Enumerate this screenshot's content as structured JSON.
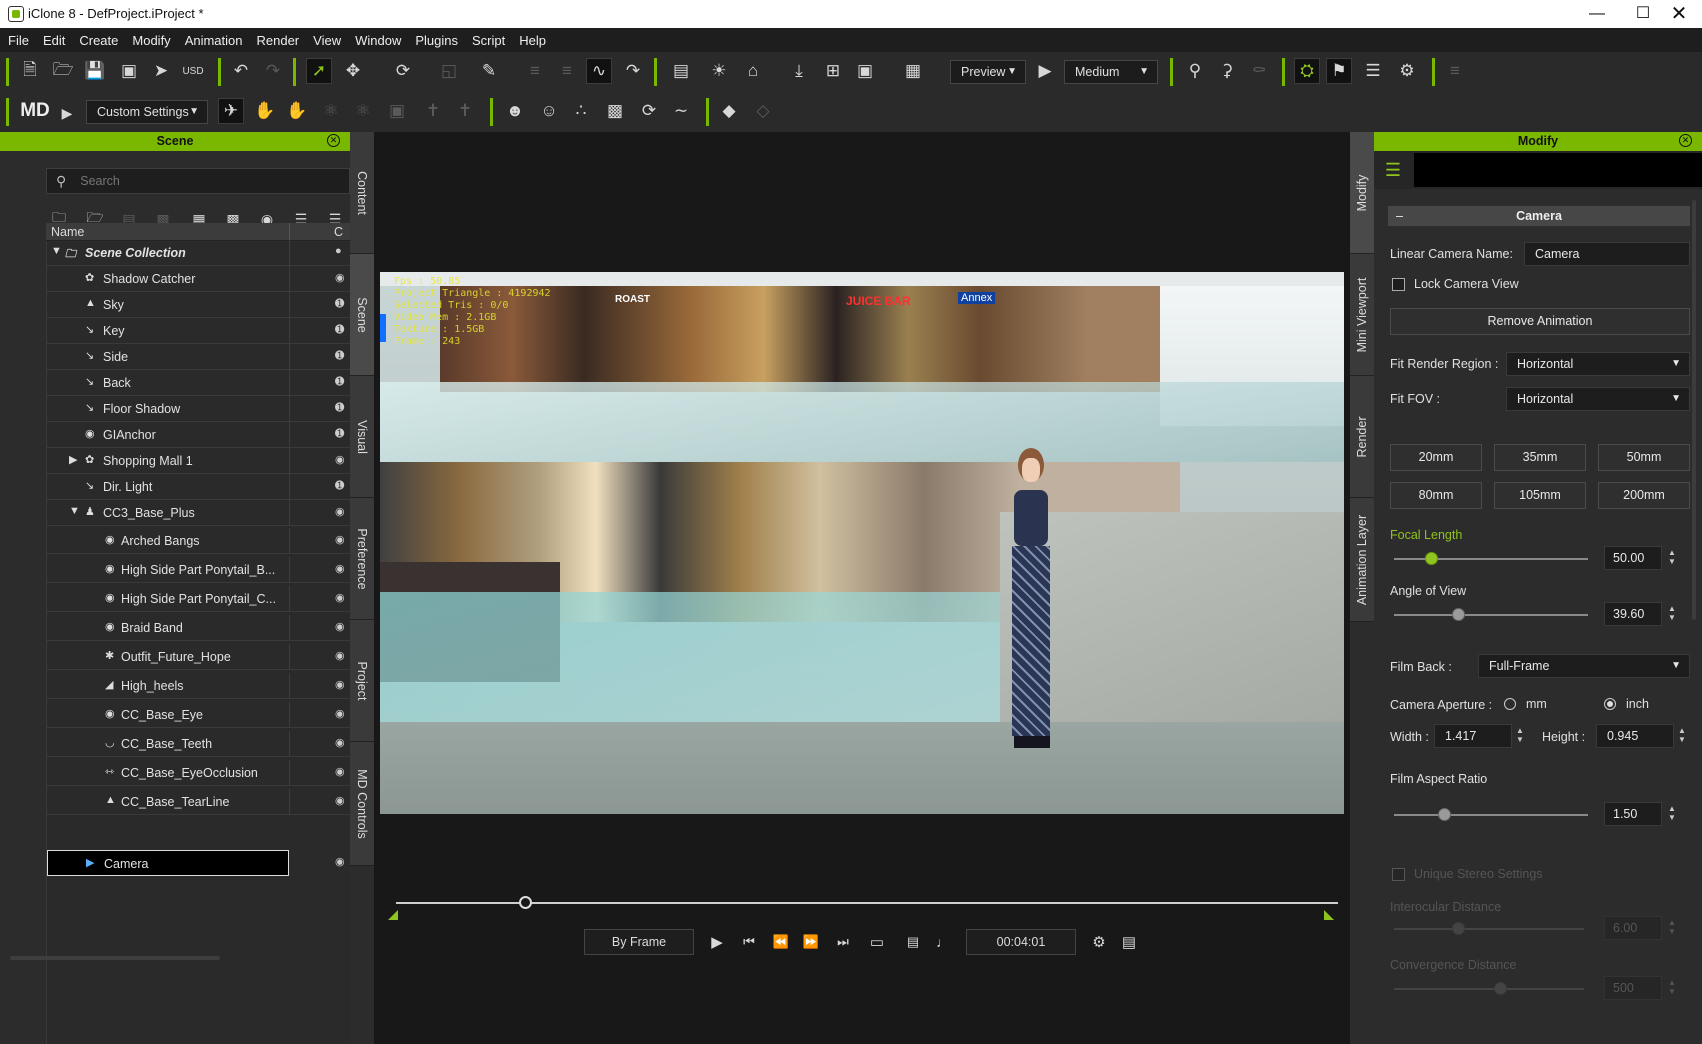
{
  "window": {
    "title": "iClone 8 - DefProject.iProject *"
  },
  "menu": [
    "File",
    "Edit",
    "Create",
    "Modify",
    "Animation",
    "Render",
    "View",
    "Window",
    "Plugins",
    "Script",
    "Help"
  ],
  "toolbar": {
    "preview": "Preview",
    "quality": "Medium",
    "custom_settings": "Custom Settings"
  },
  "scene_panel": {
    "title": "Scene",
    "search_placeholder": "Search",
    "col_name": "Name",
    "col_c": "C",
    "items": [
      {
        "label": "Scene Collection",
        "icon": "folder-icon"
      },
      {
        "label": "Shadow Catcher",
        "icon": "shadow-catcher-icon"
      },
      {
        "label": "Sky",
        "icon": "sky-icon"
      },
      {
        "label": "Key",
        "icon": "light-icon"
      },
      {
        "label": "Side",
        "icon": "light-icon"
      },
      {
        "label": "Back",
        "icon": "light-icon"
      },
      {
        "label": "Floor Shadow",
        "icon": "light-icon"
      },
      {
        "label": "GIAnchor",
        "icon": "gi-anchor-icon"
      },
      {
        "label": "Shopping Mall 1",
        "icon": "prop-icon"
      },
      {
        "label": "Dir. Light",
        "icon": "light-icon"
      },
      {
        "label": "CC3_Base_Plus",
        "icon": "avatar-icon"
      },
      {
        "label": "Arched Bangs",
        "icon": "hair-icon"
      },
      {
        "label": "High Side Part Ponytail_B...",
        "icon": "hair-icon"
      },
      {
        "label": "High Side Part Ponytail_C...",
        "icon": "hair-icon"
      },
      {
        "label": "Braid Band",
        "icon": "hair-icon"
      },
      {
        "label": "Outfit_Future_Hope",
        "icon": "cloth-icon"
      },
      {
        "label": "High_heels",
        "icon": "shoe-icon"
      },
      {
        "label": "CC_Base_Eye",
        "icon": "eye-icon"
      },
      {
        "label": "CC_Base_Teeth",
        "icon": "teeth-icon"
      },
      {
        "label": "CC_Base_EyeOcclusion",
        "icon": "eye-occlusion-icon"
      },
      {
        "label": "CC_Base_TearLine",
        "icon": "tear-icon"
      },
      {
        "label": "Camera",
        "icon": "camera-icon"
      }
    ]
  },
  "side_tabs_left": [
    "Content",
    "Scene",
    "Visual",
    "Preference",
    "Project",
    "MD Controls"
  ],
  "side_tabs_right": [
    "Modify",
    "Mini Viewport",
    "Render",
    "Animation Layer"
  ],
  "viewport": {
    "stats": [
      "Fps : 50.85",
      "Project Triangle : 4192942",
      "Selected Tris : 0/0",
      "Video Mem : 2.1GB",
      "Texture : 1.5GB",
      "Frame : 243"
    ],
    "signs": [
      "ROAST",
      "JUICE BAR",
      "Annex"
    ]
  },
  "timeline": {
    "mode": "By Frame",
    "time": "00:04:01",
    "progress": 0.137
  },
  "modify_panel": {
    "title": "Modify",
    "section": "Camera",
    "linear_camera_name_label": "Linear Camera Name:",
    "linear_camera_name": "Camera",
    "lock_camera_view": "Lock Camera View",
    "remove_animation": "Remove Animation",
    "fit_render_region_label": "Fit Render Region :",
    "fit_render_region": "Horizontal",
    "fit_fov_label": "Fit FOV :",
    "fit_fov": "Horizontal",
    "lens_presets": [
      "20mm",
      "35mm",
      "50mm",
      "80mm",
      "105mm",
      "200mm"
    ],
    "focal_length_label": "Focal Length",
    "focal_length": "50.00",
    "focal_length_level": 0.19,
    "angle_of_view_label": "Angle of View",
    "angle_of_view": "39.60",
    "angle_of_view_level": 0.33,
    "film_back_label": "Film Back :",
    "film_back": "Full-Frame",
    "camera_aperture_label": "Camera Aperture :",
    "aperture_mm": "mm",
    "aperture_inch": "inch",
    "width_label": "Width :",
    "width": "1.417",
    "height_label": "Height :",
    "height": "0.945",
    "film_aspect_ratio_label": "Film Aspect Ratio",
    "film_aspect_ratio": "1.50",
    "film_aspect_ratio_level": 0.26,
    "unique_stereo": "Unique Stereo Settings",
    "interocular_label": "Interocular Distance",
    "interocular": "6.00",
    "convergence_label": "Convergence Distance",
    "convergence": "500"
  },
  "colors": {
    "accent": "#7ab800",
    "panel_bg": "#2c2c2c",
    "viewport_bg": "#181818"
  }
}
